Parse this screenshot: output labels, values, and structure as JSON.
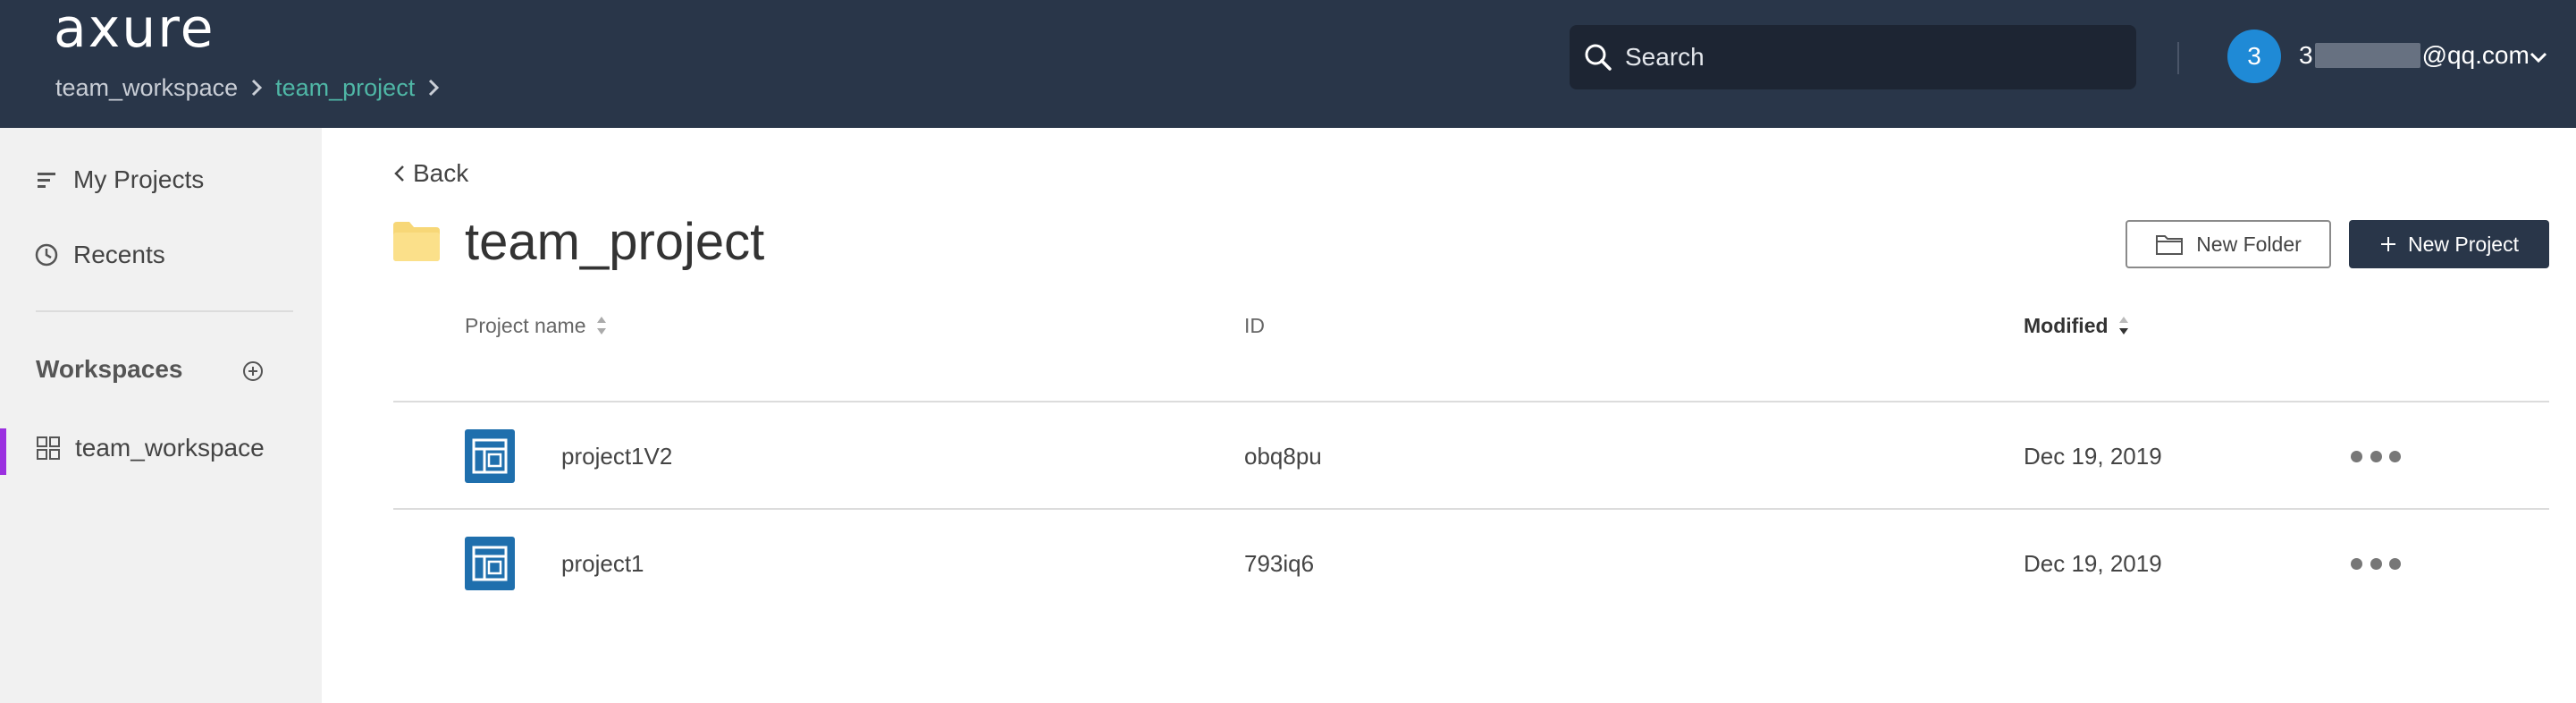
{
  "header": {
    "logo": "axure",
    "breadcrumb": [
      "team_workspace",
      "team_project"
    ],
    "search_placeholder": "Search",
    "user": {
      "avatar_initial": "3",
      "email_prefix": "3",
      "email_suffix": "@qq.com"
    }
  },
  "sidebar": {
    "my_projects": "My Projects",
    "recents": "Recents",
    "workspaces_title": "Workspaces",
    "workspaces": [
      {
        "label": "team_workspace",
        "active": true
      }
    ]
  },
  "main": {
    "back": "Back",
    "title": "team_project",
    "new_folder": "New Folder",
    "new_project": "New Project",
    "columns": {
      "name": "Project name",
      "id": "ID",
      "modified": "Modified"
    },
    "rows": [
      {
        "name": "project1V2",
        "id": "obq8pu",
        "modified": "Dec 19, 2019"
      },
      {
        "name": "project1",
        "id": "793iq6",
        "modified": "Dec 19, 2019"
      }
    ]
  },
  "colors": {
    "header_bg": "#293649",
    "accent_green": "#4fb7a6",
    "avatar_blue": "#1f8ad6",
    "active_purple": "#9b30e0",
    "project_icon": "#1f6fad",
    "folder_yellow": "#f7d777"
  }
}
